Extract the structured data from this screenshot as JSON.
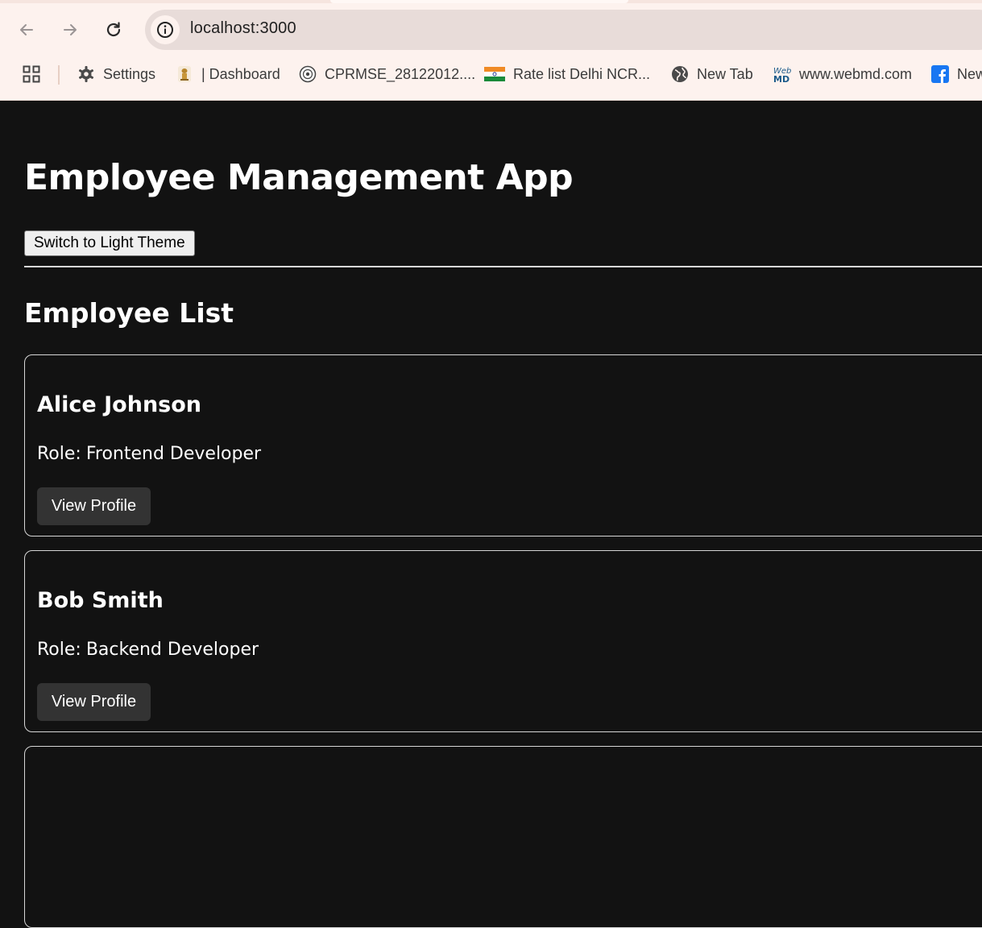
{
  "browser": {
    "url": "localhost:3000",
    "bookmarks": [
      {
        "label": "Settings",
        "icon": "gear-icon"
      },
      {
        "label": "| Dashboard",
        "icon": "emblem-icon"
      },
      {
        "label": "CPRMSE_28122012....",
        "icon": "seal-icon"
      },
      {
        "label": "Rate list Delhi NCR...",
        "icon": "india-flag-icon"
      },
      {
        "label": "New Tab",
        "icon": "globe-icon"
      },
      {
        "label": "www.webmd.com",
        "icon": "webmd-icon"
      },
      {
        "label": "New",
        "icon": "facebook-icon"
      }
    ]
  },
  "app": {
    "title": "Employee Management App",
    "theme_button": "Switch to Light Theme",
    "list_title": "Employee List",
    "employees": [
      {
        "name": "Alice Johnson",
        "role_label": "Role:",
        "role": "Frontend Developer",
        "button": "View Profile"
      },
      {
        "name": "Bob Smith",
        "role_label": "Role:",
        "role": "Backend Developer",
        "button": "View Profile"
      }
    ]
  },
  "colors": {
    "page_background": "#121212",
    "card_border": "#d6d6d6",
    "button_background": "#333333",
    "chrome_background": "#fdf2ee"
  }
}
